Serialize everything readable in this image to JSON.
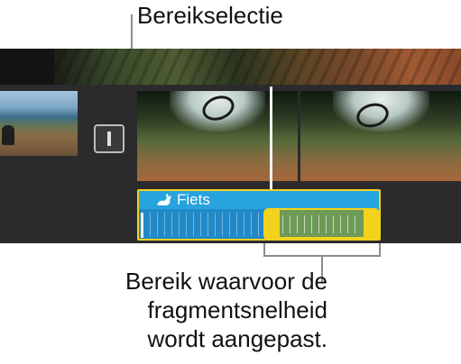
{
  "callouts": {
    "range_selection": "Bereikselectie",
    "range_description_line1": "Bereik waarvoor de",
    "range_description_line2": "fragmentsnelheid",
    "range_description_line3": "wordt aangepast."
  },
  "timeline": {
    "transition_icon": "transition-icon",
    "speed_clip": {
      "title": "Fiets",
      "icon": "rabbit-icon",
      "selection_color": "#f3d21b",
      "clip_color": "#2189c7"
    }
  },
  "colors": {
    "timeline_bg": "#2b2b2d",
    "selection_yellow": "#f3d21b",
    "speed_blue": "#27a3df"
  }
}
